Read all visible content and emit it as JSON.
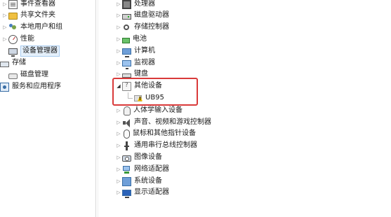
{
  "left_tree": {
    "items": [
      {
        "label": "事件查看器",
        "icon": "event-viewer-icon"
      },
      {
        "label": "共享文件夹",
        "icon": "folder-icon"
      },
      {
        "label": "本地用户和组",
        "icon": "users-icon"
      },
      {
        "label": "性能",
        "icon": "performance-icon"
      },
      {
        "label": "设备管理器",
        "icon": "device-manager-icon",
        "selected": true
      },
      {
        "label": "存储",
        "icon": "storage-icon"
      },
      {
        "label": "磁盘管理",
        "icon": "disk-icon"
      },
      {
        "label": "服务和应用程序",
        "icon": "services-icon"
      }
    ]
  },
  "device_tree": {
    "categories": [
      {
        "label": "处理器",
        "icon": "processor-icon"
      },
      {
        "label": "磁盘驱动器",
        "icon": "disk-drive-icon"
      },
      {
        "label": "存储控制器",
        "icon": "storage-controller-icon"
      },
      {
        "label": "电池",
        "icon": "battery-icon"
      },
      {
        "label": "计算机",
        "icon": "computer-icon"
      },
      {
        "label": "监视器",
        "icon": "monitor-icon"
      },
      {
        "label": "键盘",
        "icon": "keyboard-icon"
      },
      {
        "label": "其他设备",
        "icon": "other-devices-icon",
        "expanded": true
      },
      {
        "label": "人体学输入设备",
        "icon": "hid-icon"
      },
      {
        "label": "声音、视频和游戏控制器",
        "icon": "sound-icon"
      },
      {
        "label": "鼠标和其他指针设备",
        "icon": "mouse-icon"
      },
      {
        "label": "通用串行总线控制器",
        "icon": "usb-icon"
      },
      {
        "label": "图像设备",
        "icon": "imaging-icon"
      },
      {
        "label": "网络适配器",
        "icon": "network-icon"
      },
      {
        "label": "系统设备",
        "icon": "system-icon"
      },
      {
        "label": "显示适配器",
        "icon": "display-adapter-icon"
      }
    ],
    "unknown_device": {
      "label": "UB95",
      "icon": "warning-device-icon"
    }
  },
  "colors": {
    "highlight_border": "#d93a3a",
    "selection_bg": "#e5f0fb",
    "selection_border": "#a9ccef"
  }
}
